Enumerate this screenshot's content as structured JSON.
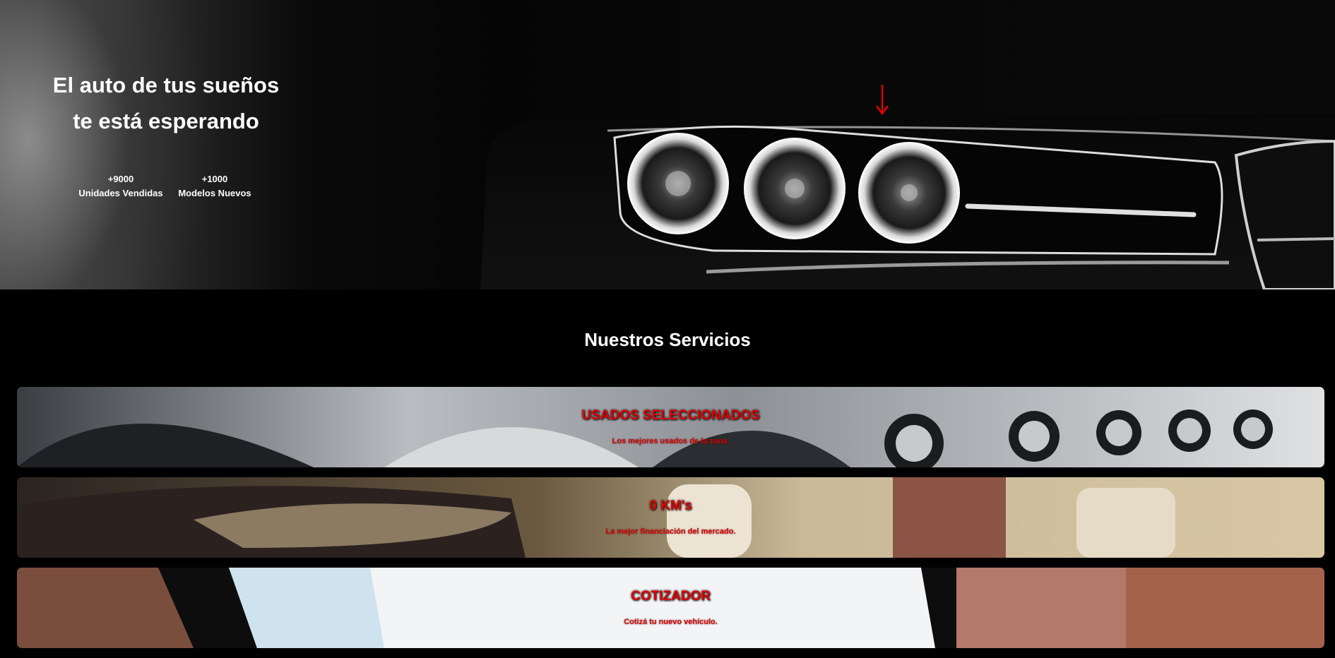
{
  "hero": {
    "title_line1": "El auto de tus sueños",
    "title_line2": "te está esperando",
    "stats": [
      {
        "number": "+9000",
        "label": "Unidades Vendidas"
      },
      {
        "number": "+1000",
        "label": "Modelos Nuevos"
      }
    ],
    "arrow_icon": "arrow-down-icon"
  },
  "services": {
    "title": "Nuestros Servicios",
    "items": [
      {
        "title": "USADOS SELECCIONADOS",
        "subtitle": "Los mejores usados de la zona."
      },
      {
        "title": "0 KM's",
        "subtitle": "La mejor financiación del mercado."
      },
      {
        "title": "COTIZADOR",
        "subtitle": "Cotizá tu nuevo vehículo."
      }
    ]
  },
  "colors": {
    "accent": "#e00000",
    "background": "#000000",
    "text": "#ffffff"
  }
}
